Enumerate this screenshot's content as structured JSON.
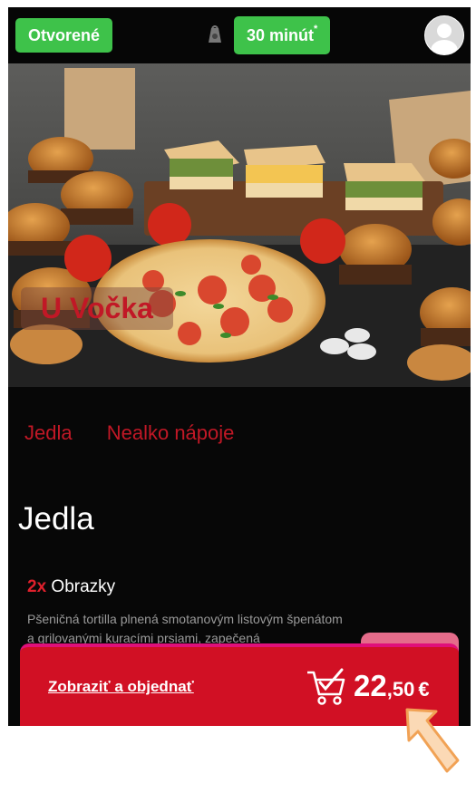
{
  "header": {
    "status": "Otvorené",
    "delivery_time": "30 minút",
    "delivery_time_mark": "*"
  },
  "hero": {
    "restaurant_name": "U Vočka"
  },
  "tabs": [
    {
      "label": "Jedla"
    },
    {
      "label": "Nealko nápoje"
    }
  ],
  "section": {
    "title": "Jedla"
  },
  "item": {
    "quantity": "2x",
    "name": "Obrazky",
    "description": "Pšeničná tortilla plnená smotanovým listovým špenátom a grilovanými kuracími prsiami, zapečená"
  },
  "cart": {
    "link_label": "Zobraziť a objednať",
    "total_integer": "22",
    "total_decimal": ",50",
    "currency": "€"
  },
  "colors": {
    "accent_green": "#3ec24a",
    "accent_red": "#d11024",
    "tab_red": "#c11826",
    "background": "#070707"
  }
}
